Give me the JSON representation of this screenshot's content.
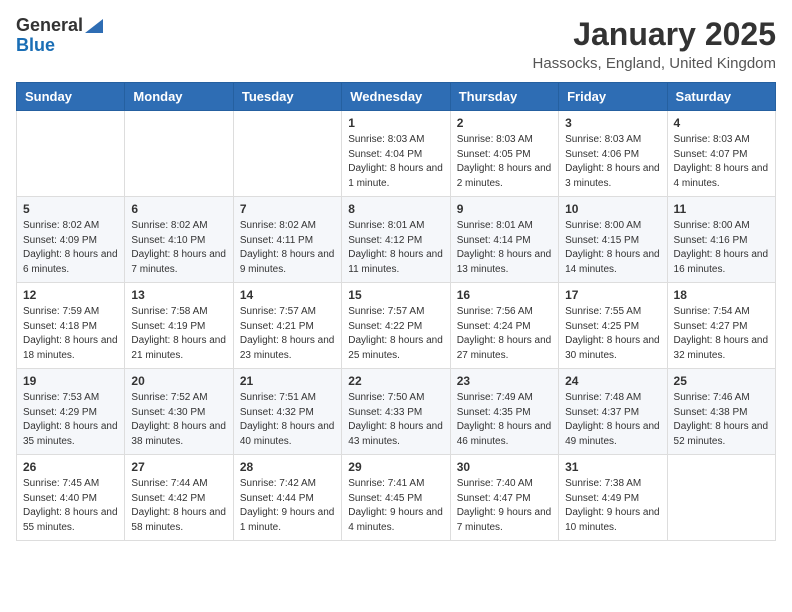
{
  "header": {
    "logo_line1": "General",
    "logo_line2": "Blue",
    "month": "January 2025",
    "location": "Hassocks, England, United Kingdom"
  },
  "weekdays": [
    "Sunday",
    "Monday",
    "Tuesday",
    "Wednesday",
    "Thursday",
    "Friday",
    "Saturday"
  ],
  "weeks": [
    [
      {
        "day": "",
        "sunrise": "",
        "sunset": "",
        "daylight": ""
      },
      {
        "day": "",
        "sunrise": "",
        "sunset": "",
        "daylight": ""
      },
      {
        "day": "",
        "sunrise": "",
        "sunset": "",
        "daylight": ""
      },
      {
        "day": "1",
        "sunrise": "Sunrise: 8:03 AM",
        "sunset": "Sunset: 4:04 PM",
        "daylight": "Daylight: 8 hours and 1 minute."
      },
      {
        "day": "2",
        "sunrise": "Sunrise: 8:03 AM",
        "sunset": "Sunset: 4:05 PM",
        "daylight": "Daylight: 8 hours and 2 minutes."
      },
      {
        "day": "3",
        "sunrise": "Sunrise: 8:03 AM",
        "sunset": "Sunset: 4:06 PM",
        "daylight": "Daylight: 8 hours and 3 minutes."
      },
      {
        "day": "4",
        "sunrise": "Sunrise: 8:03 AM",
        "sunset": "Sunset: 4:07 PM",
        "daylight": "Daylight: 8 hours and 4 minutes."
      }
    ],
    [
      {
        "day": "5",
        "sunrise": "Sunrise: 8:02 AM",
        "sunset": "Sunset: 4:09 PM",
        "daylight": "Daylight: 8 hours and 6 minutes."
      },
      {
        "day": "6",
        "sunrise": "Sunrise: 8:02 AM",
        "sunset": "Sunset: 4:10 PM",
        "daylight": "Daylight: 8 hours and 7 minutes."
      },
      {
        "day": "7",
        "sunrise": "Sunrise: 8:02 AM",
        "sunset": "Sunset: 4:11 PM",
        "daylight": "Daylight: 8 hours and 9 minutes."
      },
      {
        "day": "8",
        "sunrise": "Sunrise: 8:01 AM",
        "sunset": "Sunset: 4:12 PM",
        "daylight": "Daylight: 8 hours and 11 minutes."
      },
      {
        "day": "9",
        "sunrise": "Sunrise: 8:01 AM",
        "sunset": "Sunset: 4:14 PM",
        "daylight": "Daylight: 8 hours and 13 minutes."
      },
      {
        "day": "10",
        "sunrise": "Sunrise: 8:00 AM",
        "sunset": "Sunset: 4:15 PM",
        "daylight": "Daylight: 8 hours and 14 minutes."
      },
      {
        "day": "11",
        "sunrise": "Sunrise: 8:00 AM",
        "sunset": "Sunset: 4:16 PM",
        "daylight": "Daylight: 8 hours and 16 minutes."
      }
    ],
    [
      {
        "day": "12",
        "sunrise": "Sunrise: 7:59 AM",
        "sunset": "Sunset: 4:18 PM",
        "daylight": "Daylight: 8 hours and 18 minutes."
      },
      {
        "day": "13",
        "sunrise": "Sunrise: 7:58 AM",
        "sunset": "Sunset: 4:19 PM",
        "daylight": "Daylight: 8 hours and 21 minutes."
      },
      {
        "day": "14",
        "sunrise": "Sunrise: 7:57 AM",
        "sunset": "Sunset: 4:21 PM",
        "daylight": "Daylight: 8 hours and 23 minutes."
      },
      {
        "day": "15",
        "sunrise": "Sunrise: 7:57 AM",
        "sunset": "Sunset: 4:22 PM",
        "daylight": "Daylight: 8 hours and 25 minutes."
      },
      {
        "day": "16",
        "sunrise": "Sunrise: 7:56 AM",
        "sunset": "Sunset: 4:24 PM",
        "daylight": "Daylight: 8 hours and 27 minutes."
      },
      {
        "day": "17",
        "sunrise": "Sunrise: 7:55 AM",
        "sunset": "Sunset: 4:25 PM",
        "daylight": "Daylight: 8 hours and 30 minutes."
      },
      {
        "day": "18",
        "sunrise": "Sunrise: 7:54 AM",
        "sunset": "Sunset: 4:27 PM",
        "daylight": "Daylight: 8 hours and 32 minutes."
      }
    ],
    [
      {
        "day": "19",
        "sunrise": "Sunrise: 7:53 AM",
        "sunset": "Sunset: 4:29 PM",
        "daylight": "Daylight: 8 hours and 35 minutes."
      },
      {
        "day": "20",
        "sunrise": "Sunrise: 7:52 AM",
        "sunset": "Sunset: 4:30 PM",
        "daylight": "Daylight: 8 hours and 38 minutes."
      },
      {
        "day": "21",
        "sunrise": "Sunrise: 7:51 AM",
        "sunset": "Sunset: 4:32 PM",
        "daylight": "Daylight: 8 hours and 40 minutes."
      },
      {
        "day": "22",
        "sunrise": "Sunrise: 7:50 AM",
        "sunset": "Sunset: 4:33 PM",
        "daylight": "Daylight: 8 hours and 43 minutes."
      },
      {
        "day": "23",
        "sunrise": "Sunrise: 7:49 AM",
        "sunset": "Sunset: 4:35 PM",
        "daylight": "Daylight: 8 hours and 46 minutes."
      },
      {
        "day": "24",
        "sunrise": "Sunrise: 7:48 AM",
        "sunset": "Sunset: 4:37 PM",
        "daylight": "Daylight: 8 hours and 49 minutes."
      },
      {
        "day": "25",
        "sunrise": "Sunrise: 7:46 AM",
        "sunset": "Sunset: 4:38 PM",
        "daylight": "Daylight: 8 hours and 52 minutes."
      }
    ],
    [
      {
        "day": "26",
        "sunrise": "Sunrise: 7:45 AM",
        "sunset": "Sunset: 4:40 PM",
        "daylight": "Daylight: 8 hours and 55 minutes."
      },
      {
        "day": "27",
        "sunrise": "Sunrise: 7:44 AM",
        "sunset": "Sunset: 4:42 PM",
        "daylight": "Daylight: 8 hours and 58 minutes."
      },
      {
        "day": "28",
        "sunrise": "Sunrise: 7:42 AM",
        "sunset": "Sunset: 4:44 PM",
        "daylight": "Daylight: 9 hours and 1 minute."
      },
      {
        "day": "29",
        "sunrise": "Sunrise: 7:41 AM",
        "sunset": "Sunset: 4:45 PM",
        "daylight": "Daylight: 9 hours and 4 minutes."
      },
      {
        "day": "30",
        "sunrise": "Sunrise: 7:40 AM",
        "sunset": "Sunset: 4:47 PM",
        "daylight": "Daylight: 9 hours and 7 minutes."
      },
      {
        "day": "31",
        "sunrise": "Sunrise: 7:38 AM",
        "sunset": "Sunset: 4:49 PM",
        "daylight": "Daylight: 9 hours and 10 minutes."
      },
      {
        "day": "",
        "sunrise": "",
        "sunset": "",
        "daylight": ""
      }
    ]
  ]
}
